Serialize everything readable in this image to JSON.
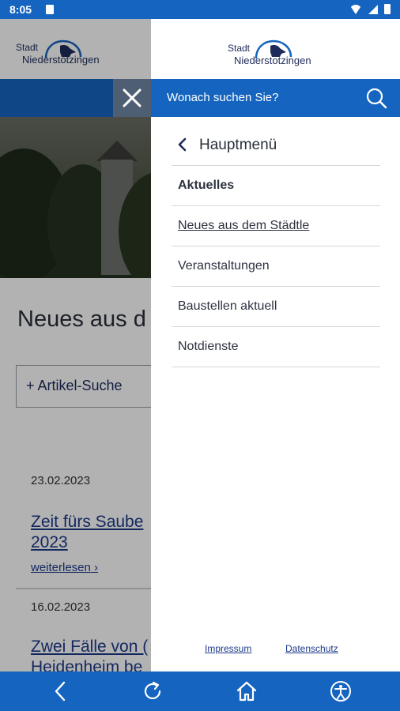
{
  "status_bar": {
    "time": "8:05"
  },
  "logo": {
    "stadt": "Stadt",
    "name": "Niederstotzingen"
  },
  "background_page": {
    "heading": "Neues aus d",
    "search_button": "+ Artikel-Suche",
    "articles": [
      {
        "date": "23.02.2023",
        "title_line1": "Zeit fürs Saube",
        "title_line2": "2023",
        "more": "weiterlesen"
      },
      {
        "date": "16.02.2023",
        "title_line1": "Zwei Fälle von (",
        "title_line2": "Heidenheim be"
      }
    ]
  },
  "drawer": {
    "search_placeholder": "Wonach suchen Sie?",
    "back_label": "Hauptmenü",
    "items": [
      {
        "label": "Aktuelles",
        "style": "bold"
      },
      {
        "label": "Neues aus dem Städtle",
        "style": "underline"
      },
      {
        "label": "Veranstaltungen",
        "style": "normal"
      },
      {
        "label": "Baustellen aktuell",
        "style": "normal"
      },
      {
        "label": "Notdienste",
        "style": "normal"
      }
    ],
    "footer": {
      "impressum": "Impressum",
      "datenschutz": "Datenschutz"
    }
  },
  "bottom_nav": {
    "icons": [
      "back-icon",
      "reload-icon",
      "home-icon",
      "accessibility-icon"
    ]
  },
  "colors": {
    "primary": "#1565c0",
    "navy": "#1e2b5a",
    "close_button": "#4f5f73"
  }
}
